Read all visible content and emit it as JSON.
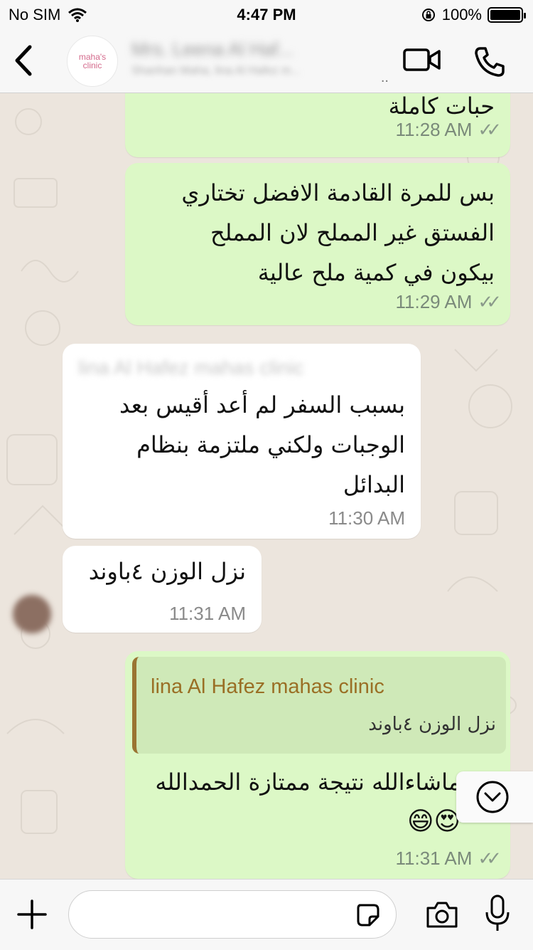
{
  "status_bar": {
    "carrier": "No SIM",
    "time": "4:47 PM",
    "battery_percent": "100%",
    "battery_level": 1.0
  },
  "header": {
    "back_label": "Back",
    "avatar_line1": "maha's",
    "avatar_line2": "clinic",
    "contact_name": "Mrs. Leena Al Haf...",
    "contact_subtitle": "Shanhan Maha, lina Al Hafez m...",
    "more_dots": ".."
  },
  "messages": [
    {
      "id": "m1",
      "direction": "outgoing",
      "text": "حبات كاملة",
      "time": "11:28 AM",
      "ticks": "✓✓"
    },
    {
      "id": "m2",
      "direction": "outgoing",
      "lines": [
        "بس للمرة القادمة الافضل تختاري",
        "الفستق غير المملح لان المملح",
        "بيكون في كمية ملح عالية"
      ],
      "time": "11:29 AM",
      "ticks": "✓✓"
    },
    {
      "id": "m3",
      "direction": "incoming",
      "sender": "lina Al Hafez mahas clinic",
      "lines": [
        "بسبب السفر لم أعد أقيس بعد",
        "الوجبات ولكني ملتزمة بنظام",
        "البدائل"
      ],
      "time": "11:30 AM"
    },
    {
      "id": "m4",
      "direction": "incoming",
      "text": "نزل الوزن ٤باوند",
      "time": "11:31 AM"
    },
    {
      "id": "m5",
      "direction": "outgoing",
      "reply_to": {
        "name": "lina Al Hafez mahas clinic",
        "text": "نزل الوزن ٤باوند"
      },
      "lines": [
        "ماشاءالله نتيجة ممتازة الحمدالله",
        "😍😄"
      ],
      "time": "11:31 AM",
      "ticks": "✓✓"
    }
  ],
  "input": {
    "placeholder": "",
    "value": ""
  },
  "colors": {
    "outgoing_bubble": "#dcf8c6",
    "incoming_bubble": "#ffffff",
    "chat_background": "#ece5dd",
    "reply_accent": "#9a7432"
  },
  "icons": [
    "wifi-icon",
    "lock-rotation-icon",
    "battery-icon",
    "back-chevron-icon",
    "video-call-icon",
    "phone-call-icon",
    "scroll-down-icon",
    "plus-icon",
    "sticker-icon",
    "camera-icon",
    "mic-icon"
  ]
}
